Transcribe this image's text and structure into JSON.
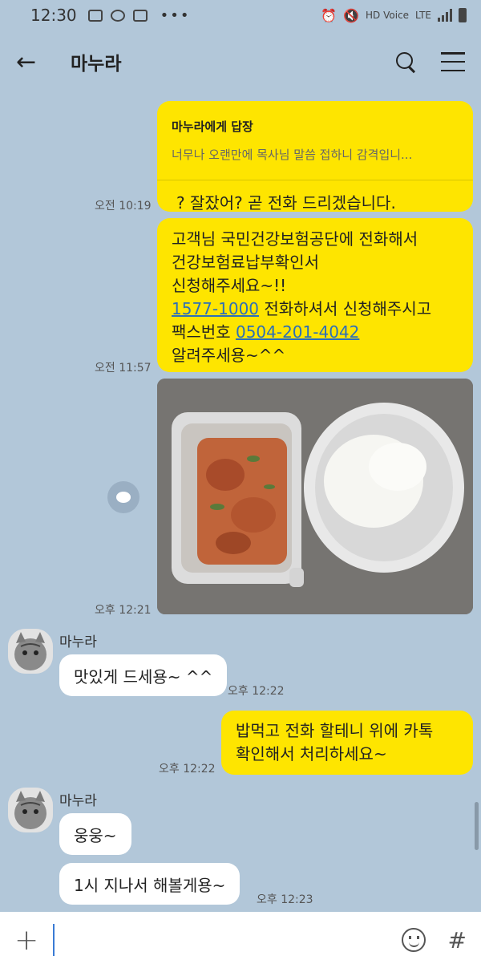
{
  "status_bar": {
    "time": "12:30",
    "network": "LTE",
    "voice": "HD Voice"
  },
  "header": {
    "back_icon": "arrow-left-icon",
    "title": "마누라",
    "search_icon": "search-icon",
    "menu_icon": "menu-icon"
  },
  "messages": [
    {
      "type": "reply",
      "reply_to": "마누라에게 답장",
      "quote": "너무나 오랜만에 목사님 말씀 접하니 감격입니...",
      "text": "? 잘잤어? 곧 전화 드리겠습니다.",
      "time": "오전 10:19"
    },
    {
      "type": "text",
      "lines": [
        "고객님 국민건강보험공단에 전화해서",
        "건강보험료납부확인서",
        "신청해주세요~!!"
      ],
      "phone": "1577-1000",
      "phone_suffix": " 전화하셔서 신청해주시고",
      "fax_label": "팩스번호 ",
      "fax": "0504-201-4042",
      "closing": "알려주세용~^^",
      "time": "오전 11:57"
    },
    {
      "type": "photo",
      "time": "오후 12:21"
    },
    {
      "type": "incoming",
      "sender": "마누라",
      "text": "맛있게 드세용~ ^^",
      "time": "오후 12:22"
    },
    {
      "type": "outgoing",
      "lines": [
        "밥먹고 전화 할테니 위에 카톡",
        "확인해서 처리하세요~"
      ],
      "time": "오후 12:22"
    },
    {
      "type": "incoming",
      "sender": "마누라",
      "texts": [
        "웅웅~",
        "1시 지나서 해볼게용~"
      ],
      "time": "오후 12:23"
    }
  ],
  "input": {
    "placeholder": "",
    "plus_icon": "plus-icon",
    "emoji_icon": "emoji-icon",
    "hash_icon": "hash-icon"
  }
}
